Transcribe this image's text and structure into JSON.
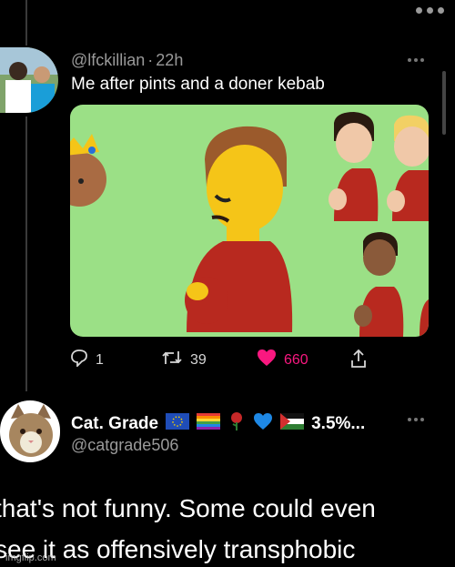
{
  "tweet": {
    "handle": "@lfckillian",
    "time": "22h",
    "separator": "·",
    "text": "Me after pints and a doner kebab",
    "actions": {
      "replies": "1",
      "retweets": "39",
      "likes": "660"
    }
  },
  "reply_author": {
    "display_name": "Cat. Grade",
    "name_suffix": "3.5%...",
    "handle": "@catgrade506",
    "emojis": [
      "eu-flag-icon",
      "rainbow-flag-icon",
      "rose-icon",
      "blue-heart-icon",
      "palestine-flag-icon"
    ]
  },
  "reply_text": {
    "line1": "that's not funny.  Some could even",
    "line2": "see it as offensively transphobic"
  },
  "watermark": "imgflip.com",
  "colors": {
    "background": "#000000",
    "like": "#f91880",
    "media_bg": "#9be086",
    "emoji_skin": "#f5c518",
    "shirt": "#b8291f"
  }
}
